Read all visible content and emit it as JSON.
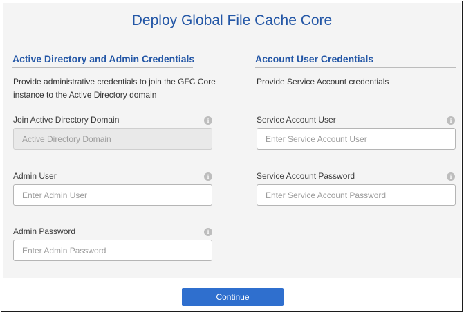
{
  "dialog": {
    "title": "Deploy Global File Cache Core",
    "continue_label": "Continue"
  },
  "left": {
    "heading": "Active Directory and Admin Credentials",
    "description_line1": "Provide administrative credentials to join the GFC Core",
    "description_line2": "instance to the Active Directory domain",
    "fields": [
      {
        "label": "Join Active Directory Domain",
        "placeholder": "Active Directory Domain",
        "value": "",
        "disabled": true
      },
      {
        "label": "Admin User",
        "placeholder": "Enter Admin User",
        "value": "",
        "disabled": false
      },
      {
        "label": "Admin Password",
        "placeholder": "Enter Admin Password",
        "value": "",
        "disabled": false
      }
    ]
  },
  "right": {
    "heading": "Account User Credentials",
    "description": "Provide Service Account credentials",
    "fields": [
      {
        "label": "Service Account User",
        "placeholder": "Enter Service Account User",
        "value": ""
      },
      {
        "label": "Service Account Password",
        "placeholder": "Enter Service Account Password",
        "value": ""
      }
    ]
  },
  "info_glyph": "i"
}
